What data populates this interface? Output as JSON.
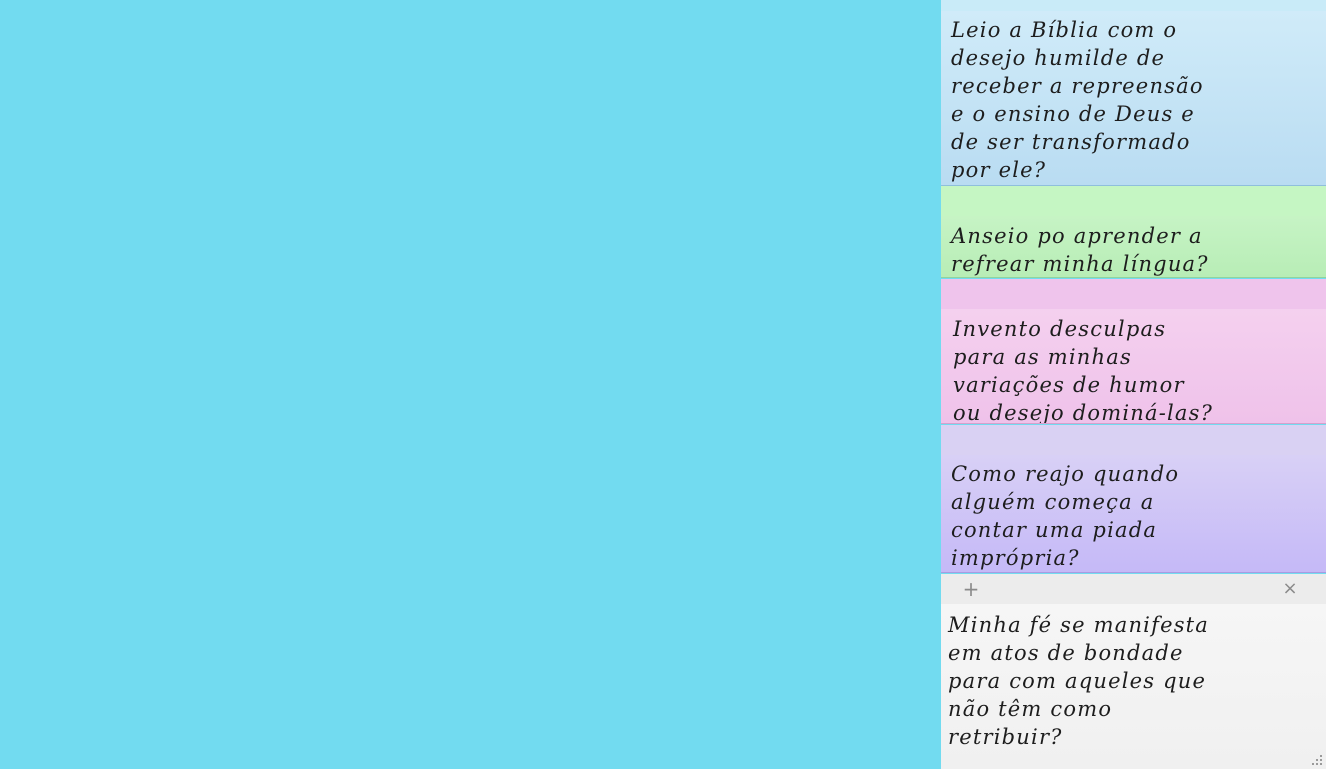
{
  "notes": [
    {
      "id": "note-1",
      "color": "#c9ebf8",
      "text": "Leio a Bíblia com o\ndesejo humilde de\nreceber a repreensão\ne o ensino de Deus e\nde ser transformado\npor ele?"
    },
    {
      "id": "note-2",
      "color": "#c5f6c3",
      "text": "Anseio po aprender a\nrefrear minha língua?"
    },
    {
      "id": "note-3",
      "color": "#efc4ec",
      "text": "Invento desculpas\npara as minhas\nvariações de humor\nou desejo dominá-las?"
    },
    {
      "id": "note-4",
      "color": "#d9d1f3",
      "text": "Como reajo quando\nalguém começa a\ncontar uma piada\nimprópria?"
    },
    {
      "id": "note-5",
      "color": "#f4f4f4",
      "active": true,
      "add_icon": "+",
      "close_icon": "×",
      "text": "Minha fé se manifesta\nem atos de bondade\npara com aqueles que\nnão têm como\nretribuir?"
    }
  ],
  "desktop": {
    "background_color": "#72dbf0"
  },
  "icons": {
    "add": "plus-icon",
    "close": "close-icon",
    "resize": "resize-grip-icon"
  }
}
